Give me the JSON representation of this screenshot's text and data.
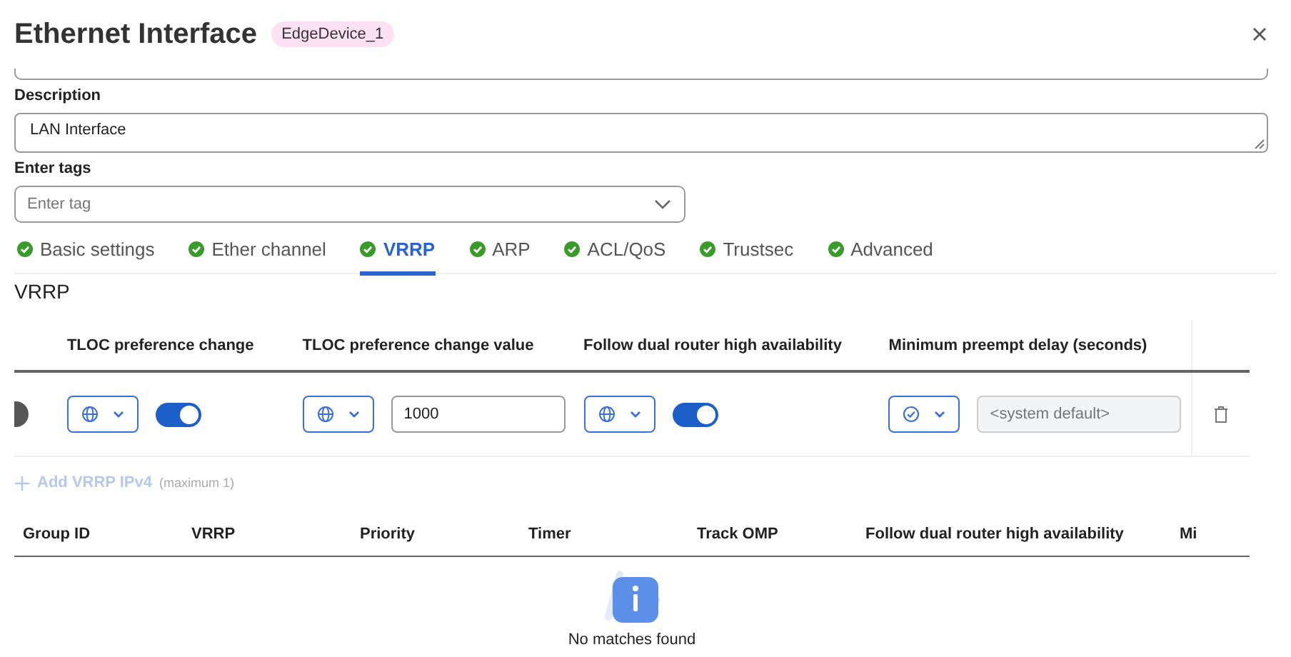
{
  "header": {
    "title": "Ethernet Interface",
    "device_badge": "EdgeDevice_1"
  },
  "form": {
    "description": {
      "label": "Description",
      "value": "LAN Interface"
    },
    "tags": {
      "label": "Enter tags",
      "placeholder": "Enter tag"
    }
  },
  "tabs": [
    {
      "label": "Basic settings",
      "selected": false,
      "complete": true
    },
    {
      "label": "Ether channel",
      "selected": false,
      "complete": true
    },
    {
      "label": "VRRP",
      "selected": true,
      "complete": true
    },
    {
      "label": "ARP",
      "selected": false,
      "complete": true
    },
    {
      "label": "ACL/QoS",
      "selected": false,
      "complete": true
    },
    {
      "label": "Trustsec",
      "selected": false,
      "complete": true
    },
    {
      "label": "Advanced",
      "selected": false,
      "complete": true
    }
  ],
  "section_title": "VRRP",
  "vrrp_table": {
    "columns": [
      "TLOC preference change",
      "TLOC preference change value",
      "Follow dual router high availability",
      "Minimum preempt delay (seconds)"
    ],
    "cut_toggle": {
      "on": false
    },
    "cells": [
      {
        "kind": "global_toggle",
        "on": true
      },
      {
        "kind": "global_value",
        "value": "1000",
        "disabled": false
      },
      {
        "kind": "global_toggle",
        "on": true
      },
      {
        "kind": "default_value",
        "placeholder": "<system default>",
        "disabled": true
      }
    ]
  },
  "add_link": {
    "label": "Add VRRP IPv4",
    "note": "(maximum 1)",
    "disabled": true
  },
  "ipv4_table": {
    "columns": [
      "Group ID",
      "VRRP",
      "Priority",
      "Timer",
      "Track OMP",
      "Follow dual router high availability",
      "Mi"
    ],
    "empty_message": "No matches found"
  }
}
